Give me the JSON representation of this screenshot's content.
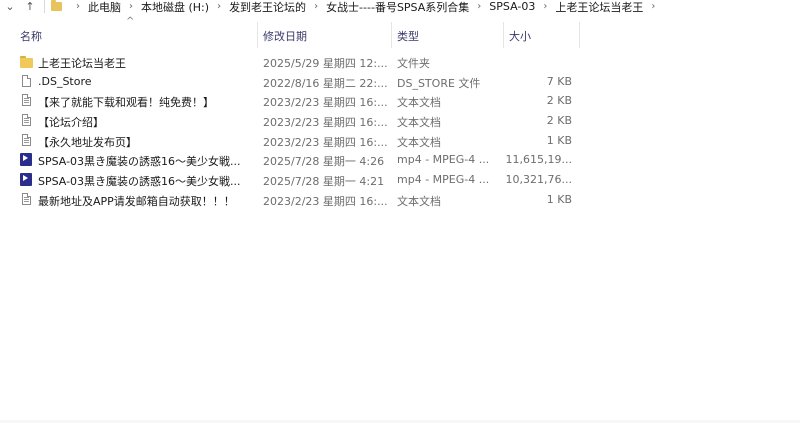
{
  "addressbar": {
    "nav_down": "⌄",
    "nav_up": "↑",
    "breadcrumbs": [
      "此电脑",
      "本地磁盘 (H:)",
      "发到老王论坛的",
      "女战士----番号SPSA系列合集",
      "SPSA-03",
      "上老王论坛当老王"
    ],
    "separator": "›"
  },
  "columns": {
    "name": "名称",
    "date": "修改日期",
    "type": "类型",
    "size": "大小",
    "sort_indicator": "^"
  },
  "files": [
    {
      "icon": "folder-icon",
      "name": "上老王论坛当老王",
      "date": "2025/5/29 星期四 12:...",
      "type": "文件夹",
      "size": ""
    },
    {
      "icon": "file-icon",
      "name": ".DS_Store",
      "date": "2022/8/16 星期二 22:...",
      "type": "DS_STORE 文件",
      "size": "7 KB"
    },
    {
      "icon": "text-file-icon",
      "name": "【来了就能下载和观看！纯免费！】",
      "date": "2023/2/23 星期四 16:...",
      "type": "文本文档",
      "size": "2 KB"
    },
    {
      "icon": "text-file-icon",
      "name": "【论坛介绍】",
      "date": "2023/2/23 星期四 16:...",
      "type": "文本文档",
      "size": "2 KB"
    },
    {
      "icon": "text-file-icon",
      "name": "【永久地址发布页】",
      "date": "2023/2/23 星期四 16:...",
      "type": "文本文档",
      "size": "1 KB"
    },
    {
      "icon": "video-file-icon",
      "name": "SPSA-03黒き魔装の誘惑16～美少女戦...",
      "date": "2025/7/28 星期一 4:26",
      "type": "mp4 - MPEG-4 ...",
      "size": "11,615,19..."
    },
    {
      "icon": "video-file-icon",
      "name": "SPSA-03黒き魔装の誘惑16～美少女戦...",
      "date": "2025/7/28 星期一 4:21",
      "type": "mp4 - MPEG-4 ...",
      "size": "10,321,76..."
    },
    {
      "icon": "text-file-icon",
      "name": "最新地址及APP请发邮箱自动获取！！！",
      "date": "2023/2/23 星期四 16:...",
      "type": "文本文档",
      "size": "1 KB"
    }
  ],
  "colors": {
    "folder": "#f0c95a",
    "mp4_icon": "#2b2d8c",
    "header_text": "#3a3a6a",
    "meta_text": "#6d6d6d"
  }
}
